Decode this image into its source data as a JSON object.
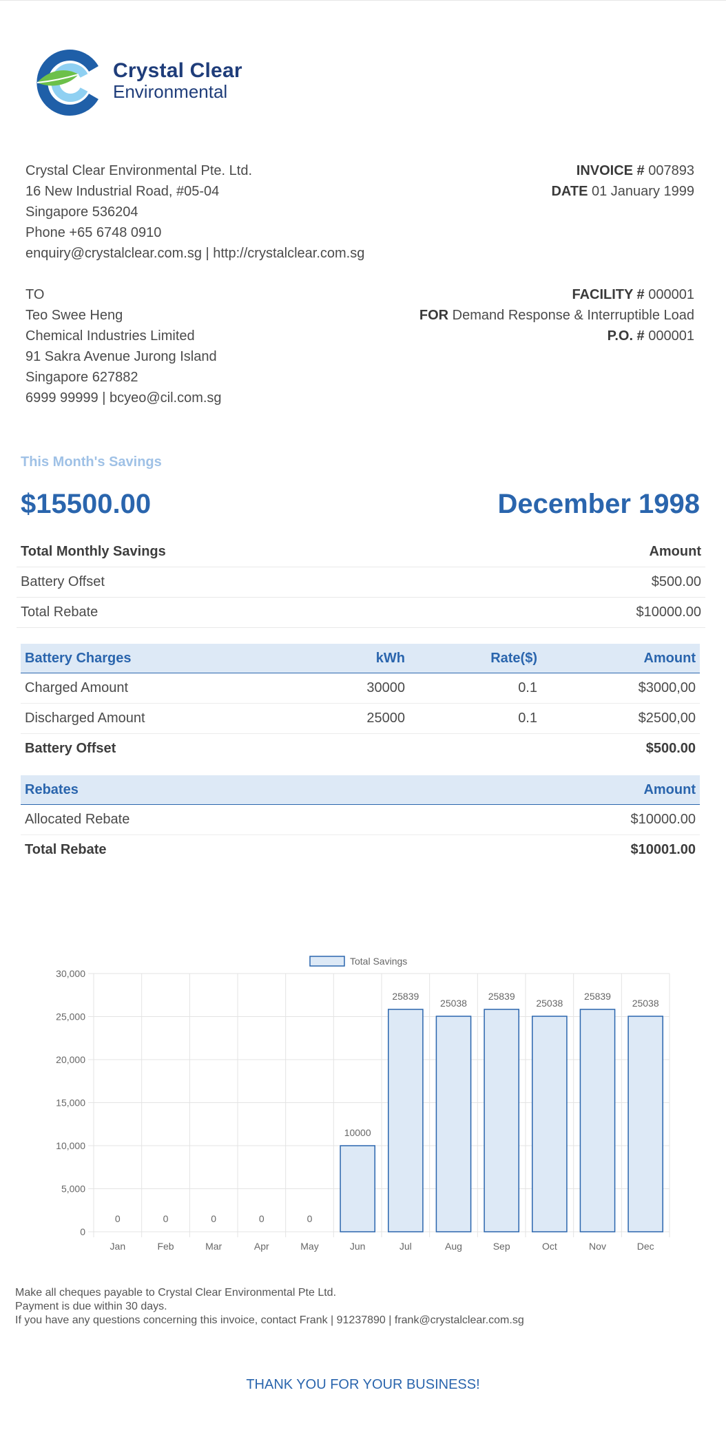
{
  "logo": {
    "line1": "Crystal Clear",
    "line2": "Environmental",
    "brand_dark": "#1f5fa8",
    "brand_light": "#8fd0f2",
    "leaf": "#6cc04a"
  },
  "company": {
    "name": "Crystal Clear Environmental Pte. Ltd.",
    "address": "16 New Industrial Road, #05-04",
    "city": "Singapore 536204",
    "phone": "Phone +65 6748 0910",
    "contact": "enquiry@crystalclear.com.sg | http://crystalclear.com.sg"
  },
  "invoice": {
    "number_label": "INVOICE #",
    "number": "007893",
    "date_label": "DATE",
    "date": "01 January 1999"
  },
  "recipient": {
    "to_label": "TO",
    "name": "Teo Swee Heng",
    "company": "Chemical Industries Limited",
    "address": "91 Sakra Avenue Jurong Island",
    "city": "Singapore 627882",
    "contact": "6999 99999 | bcyeo@cil.com.sg"
  },
  "facility": {
    "facility_label": "FACILITY #",
    "facility": "000001",
    "for_label": "FOR",
    "for": "Demand Response & Interruptible Load",
    "po_label": "P.O. #",
    "po": "000001"
  },
  "savings": {
    "label": "This Month's Savings",
    "amount": "$15500.00",
    "month": "December 1998"
  },
  "summary": {
    "headers": [
      "Total Monthly Savings",
      "Amount"
    ],
    "rows": [
      {
        "label": "Battery Offset",
        "amount": "$500.00"
      },
      {
        "label": "Total Rebate",
        "amount": "$10000.00"
      }
    ]
  },
  "battery": {
    "headers": [
      "Battery Charges",
      "kWh",
      "Rate($)",
      "Amount"
    ],
    "rows": [
      {
        "label": "Charged Amount",
        "kwh": "30000",
        "rate": "0.1",
        "amount": "$3000,00"
      },
      {
        "label": "Discharged Amount",
        "kwh": "25000",
        "rate": "0.1",
        "amount": "$2500,00"
      }
    ],
    "total_label": "Battery Offset",
    "total": "$500.00"
  },
  "rebates": {
    "headers": [
      "Rebates",
      "Amount"
    ],
    "rows": [
      {
        "label": "Allocated Rebate",
        "amount": "$10000.00"
      }
    ],
    "total_label": "Total Rebate",
    "total": "$10001.00"
  },
  "chart_data": {
    "type": "bar",
    "categories": [
      "Jan",
      "Feb",
      "Mar",
      "Apr",
      "May",
      "Jun",
      "Jul",
      "Aug",
      "Sep",
      "Oct",
      "Nov",
      "Dec"
    ],
    "series": [
      {
        "name": "Total Savings",
        "values": [
          0,
          0,
          0,
          0,
          0,
          10000,
          25839,
          25038,
          25839,
          25038,
          25839,
          25038
        ]
      }
    ],
    "ylim": [
      0,
      30000
    ],
    "yticks": [
      "0",
      "5,000",
      "10,000",
      "15,000",
      "20,000",
      "25,000",
      "30,000"
    ],
    "grid": true,
    "legend": "top-center",
    "bar_fill": "#dde9f6",
    "bar_stroke": "#2a65ad"
  },
  "footer": {
    "line1": "Make all cheques payable to Crystal Clear Environmental Pte Ltd.",
    "line2": "Payment is due within 30 days.",
    "line3": "If you have any questions concerning this invoice, contact Frank | 91237890 | frank@crystalclear.com.sg",
    "thanks": "THANK YOU FOR YOUR BUSINESS!"
  }
}
